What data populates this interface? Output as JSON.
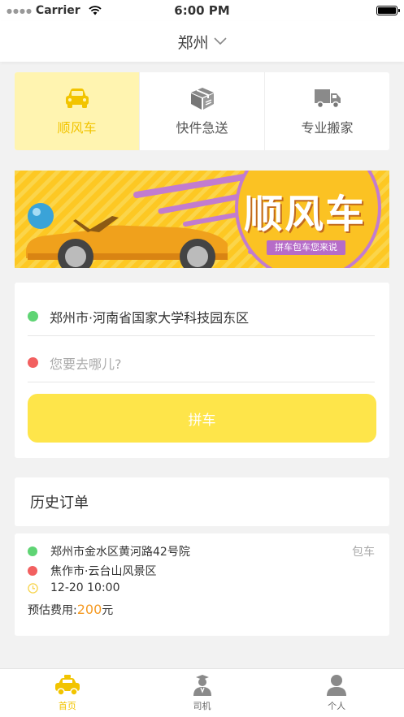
{
  "status_bar": {
    "carrier": "Carrier",
    "time": "6:00 PM"
  },
  "nav": {
    "city": "郑州"
  },
  "service_tabs": [
    {
      "label": "顺风车",
      "icon": "car-icon",
      "active": true
    },
    {
      "label": "快件急送",
      "icon": "package-icon",
      "active": false
    },
    {
      "label": "专业搬家",
      "icon": "truck-icon",
      "active": false
    }
  ],
  "banner": {
    "title": "顺风车",
    "subtitle": "拼车包车您来说"
  },
  "route": {
    "from": "郑州市·河南省国家大学科技园东区",
    "to_placeholder": "您要去哪儿?",
    "button_label": "拼车"
  },
  "history": {
    "title": "历史订单",
    "orders": [
      {
        "from": "郑州市金水区黄河路42号院",
        "to": "焦作市·云台山风景区",
        "time": "12-20 10:00",
        "type": "包车",
        "fee_label": "预估费用:",
        "fee_amount": "200",
        "fee_unit": "元"
      }
    ]
  },
  "tabbar": [
    {
      "label": "首页",
      "icon": "taxi-icon",
      "active": true
    },
    {
      "label": "司机",
      "icon": "driver-icon",
      "active": false
    },
    {
      "label": "个人",
      "icon": "person-icon",
      "active": false
    }
  ],
  "colors": {
    "accent": "#fee54a",
    "active_text": "#f2c400",
    "fee": "#f59a23",
    "start_dot": "#5fd474",
    "end_dot": "#f26060"
  }
}
